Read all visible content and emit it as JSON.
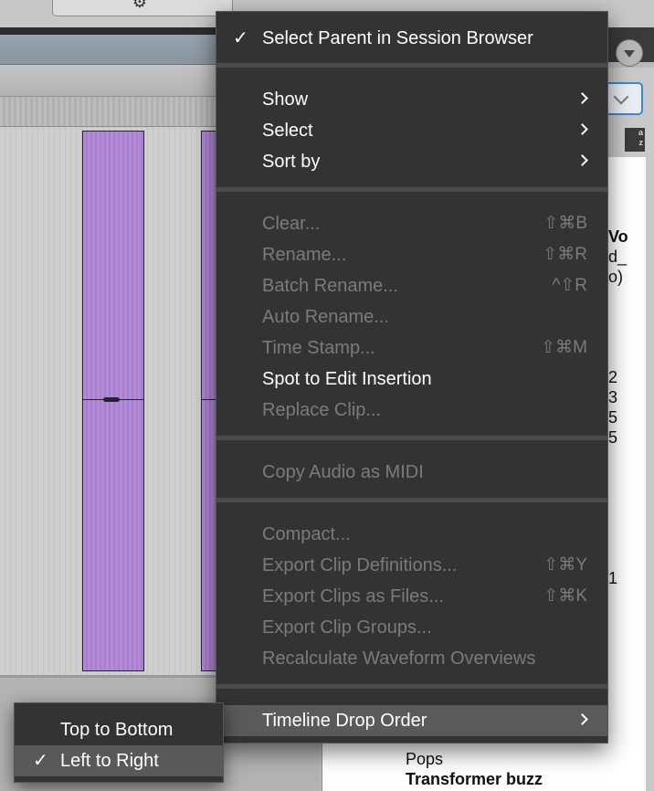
{
  "menu": {
    "items": [
      {
        "label": "Select Parent in Session Browser",
        "checked": true,
        "enabled": true
      },
      {
        "label": "Show",
        "submenu": true,
        "enabled": true
      },
      {
        "label": "Select",
        "submenu": true,
        "enabled": true
      },
      {
        "label": "Sort by",
        "submenu": true,
        "enabled": true
      },
      {
        "label": "Clear...",
        "shortcut": "⇧⌘B",
        "enabled": false
      },
      {
        "label": "Rename...",
        "shortcut": "⇧⌘R",
        "enabled": false
      },
      {
        "label": "Batch Rename...",
        "shortcut": "^⇧R",
        "enabled": false
      },
      {
        "label": "Auto Rename...",
        "enabled": false
      },
      {
        "label": "Time Stamp...",
        "shortcut": "⇧⌘M",
        "enabled": false
      },
      {
        "label": "Spot to Edit Insertion",
        "enabled": true
      },
      {
        "label": "Replace Clip...",
        "enabled": false
      },
      {
        "label": "Copy Audio as MIDI",
        "enabled": false
      },
      {
        "label": "Compact...",
        "enabled": false
      },
      {
        "label": "Export Clip Definitions...",
        "shortcut": "⇧⌘Y",
        "enabled": false
      },
      {
        "label": "Export Clips as Files...",
        "shortcut": "⇧⌘K",
        "enabled": false
      },
      {
        "label": "Export Clip Groups...",
        "enabled": false
      },
      {
        "label": "Recalculate Waveform Overviews",
        "enabled": false
      },
      {
        "label": "Timeline Drop Order",
        "submenu": true,
        "enabled": true,
        "highlighted": true
      }
    ]
  },
  "submenu": {
    "items": [
      {
        "label": "Top to Bottom",
        "checked": false
      },
      {
        "label": "Left to Right",
        "checked": true,
        "highlighted": true
      }
    ]
  },
  "check_glyph": "✓",
  "clip_list": {
    "fragments": [
      "Vo",
      "d_",
      "o)",
      "2",
      "3",
      "5",
      "5",
      "1",
      "Pops",
      "Transformer buzz"
    ]
  },
  "sort_icon_text": "a\nz",
  "colors": {
    "menu_bg": "#333333",
    "menu_highlight": "#5a5a5a",
    "clip_purple": "#b28ad8",
    "focus_blue": "#3d86d8"
  }
}
